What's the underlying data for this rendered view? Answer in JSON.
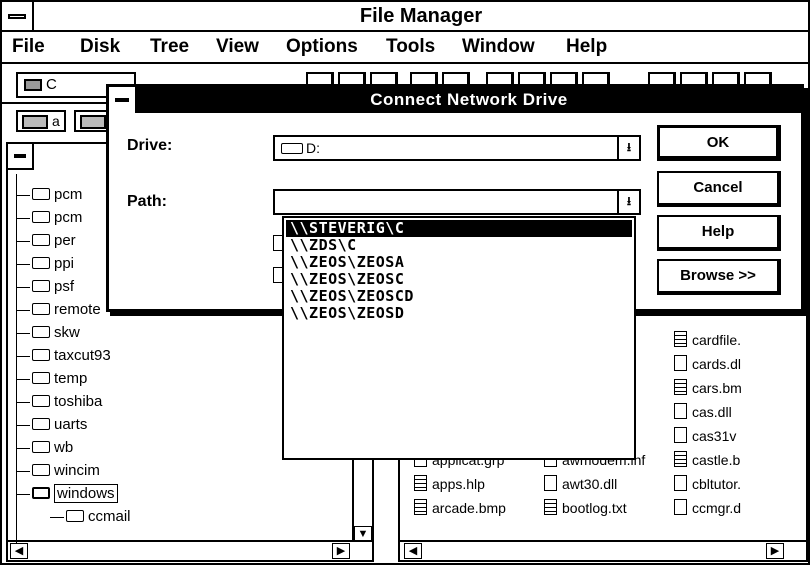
{
  "window": {
    "title": "File Manager"
  },
  "menu": [
    "File",
    "Disk",
    "Tree",
    "View",
    "Options",
    "Tools",
    "Window",
    "Help"
  ],
  "toolbar": {
    "drive_value": "C"
  },
  "drivebar": {
    "drive_a": "a"
  },
  "tree": {
    "items": [
      "pcm",
      "pcm",
      "per",
      "ppi",
      "psf",
      "remote",
      "skw",
      "taxcut93",
      "temp",
      "toshiba",
      "uarts",
      "wb",
      "wincim",
      "windows",
      "ccmail"
    ],
    "selected": "windows"
  },
  "files": [
    {
      "name": "cardfile.",
      "icon": "text-file-icon"
    },
    {
      "name": "cards.dl",
      "icon": "file-icon"
    },
    {
      "name": "cars.bm",
      "icon": "text-file-icon"
    },
    {
      "name": "cas.dll",
      "icon": "file-icon"
    },
    {
      "name": "cas31v",
      "icon": "file-icon"
    },
    {
      "name": "castle.b",
      "icon": "text-file-icon"
    },
    {
      "name": "cbltutor.",
      "icon": "file-icon"
    },
    {
      "name": "ccmgr.d",
      "icon": "file-icon"
    },
    {
      "name": "applicat.grp",
      "icon": "file-icon"
    },
    {
      "name": "awmodem.inf",
      "icon": "file-icon"
    },
    {
      "name": "apps.hlp",
      "icon": "text-file-icon"
    },
    {
      "name": "awt30.dll",
      "icon": "file-icon"
    },
    {
      "name": "arcade.bmp",
      "icon": "text-file-icon"
    },
    {
      "name": "bootlog.txt",
      "icon": "text-file-icon"
    }
  ],
  "dialog": {
    "title": "Connect Network Drive",
    "drive_label": "Drive:",
    "drive_value": "D:",
    "path_label": "Path:",
    "path_value": "",
    "buttons": {
      "ok": "OK",
      "cancel": "Cancel",
      "help": "Help",
      "browse": "Browse >>"
    }
  },
  "path_dropdown": {
    "options": [
      "\\\\STEVERIG\\C",
      "\\\\ZDS\\C",
      "\\\\ZEOS\\ZEOSA",
      "\\\\ZEOS\\ZEOSC",
      "\\\\ZEOS\\ZEOSCD",
      "\\\\ZEOS\\ZEOSD"
    ],
    "selected_index": 0
  }
}
